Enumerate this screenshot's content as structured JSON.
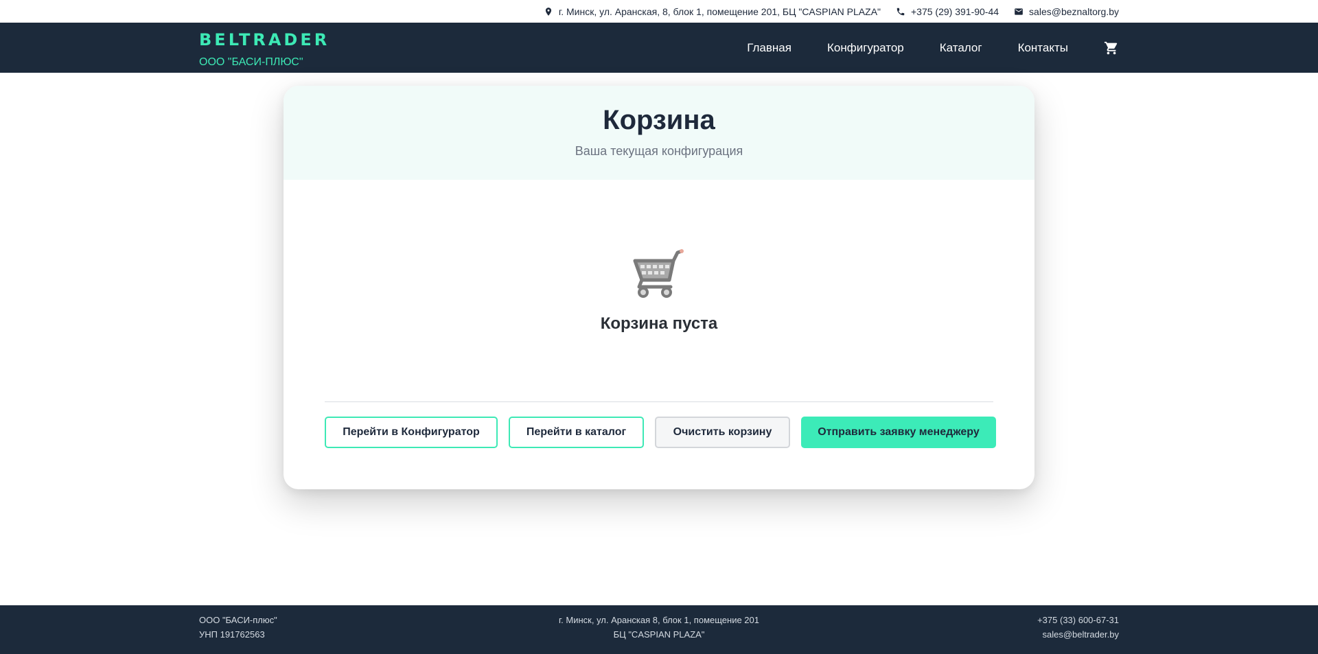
{
  "topbar": {
    "address": "г. Минск, ул. Аранская, 8, блок 1, помещение 201, БЦ \"CASPIAN PLAZA\"",
    "phone": "+375 (29) 391-90-44",
    "email": "sales@beznaltorg.by",
    "icons": [
      "location-pin-icon",
      "phone-icon",
      "mail-icon"
    ]
  },
  "header": {
    "logo": "BELTRADER",
    "company": "ООО \"БАСИ-ПЛЮС\"",
    "nav": [
      "Главная",
      "Конфигуратор",
      "Каталог",
      "Контакты"
    ],
    "cart_icon": "cart-icon"
  },
  "cart": {
    "title": "Корзина",
    "subtitle": "Ваша текущая конфигурация",
    "empty_icon": "shopping-cart-icon",
    "empty_text": "Корзина пуста",
    "buttons": {
      "configurator": "Перейти в Конфигуратор",
      "catalog": "Перейти в каталог",
      "clear": "Очистить корзину",
      "send": "Отправить заявку менеджеру"
    }
  },
  "footer": {
    "company": "ООО \"БАСИ-плюс\"",
    "unp": "УНП 191762563",
    "address_line1": "г. Минск, ул. Аранская 8, блок 1, помещение 201",
    "address_line2": "БЦ \"CASPIAN PLAZA\"",
    "phone": "+375 (33) 600-67-31",
    "email": "sales@beltrader.by"
  },
  "colors": {
    "accent": "#3de9b5",
    "header_bg": "#1c2a3b",
    "card_head_bg": "#f1fbf9"
  }
}
